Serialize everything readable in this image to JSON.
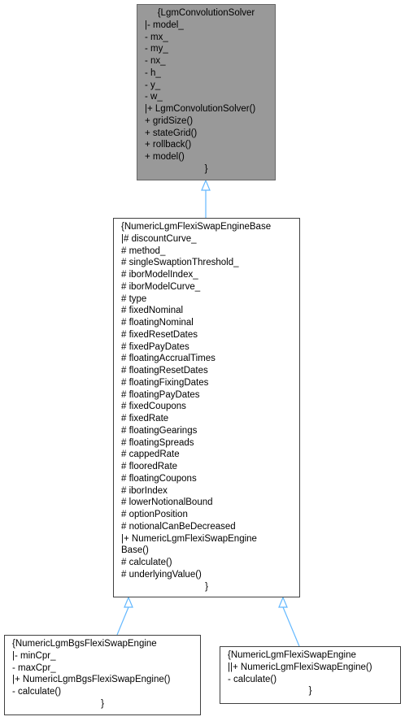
{
  "classes": {
    "solver": {
      "header": "{LgmConvolutionSolver",
      "lines": [
        "|- model_",
        "- mx_",
        "- my_",
        "- nx_",
        "- h_",
        "- y_",
        "- w_",
        "|+ LgmConvolutionSolver()",
        "+ gridSize()",
        "+ stateGrid()",
        "+ rollback()",
        "+ model()"
      ],
      "footer": "}"
    },
    "base": {
      "lines": [
        "{NumericLgmFlexiSwapEngineBase",
        "|# discountCurve_",
        "# method_",
        "# singleSwaptionThreshold_",
        "# iborModelIndex_",
        "# iborModelCurve_",
        "# type",
        "# fixedNominal",
        "# floatingNominal",
        "# fixedResetDates",
        "# fixedPayDates",
        "# floatingAccrualTimes",
        "# floatingResetDates",
        "# floatingFixingDates",
        "# floatingPayDates",
        "# fixedCoupons",
        "# fixedRate",
        "# floatingGearings",
        "# floatingSpreads",
        "# cappedRate",
        "# flooredRate",
        "# floatingCoupons",
        "# iborIndex",
        "# lowerNotionalBound",
        "# optionPosition",
        "# notionalCanBeDecreased",
        "|+ NumericLgmFlexiSwapEngine",
        "Base()",
        "# calculate()",
        "# underlyingValue()"
      ],
      "footer": "}"
    },
    "bgs": {
      "lines": [
        "{NumericLgmBgsFlexiSwapEngine",
        "|- minCpr_",
        "- maxCpr_",
        "|+ NumericLgmBgsFlexiSwapEngine()",
        "- calculate()"
      ],
      "footer": "}"
    },
    "flexi": {
      "lines": [
        "{NumericLgmFlexiSwapEngine",
        "||+ NumericLgmFlexiSwapEngine()",
        "- calculate()"
      ],
      "footer": "}"
    }
  },
  "colors": {
    "edge": "#63b8ff",
    "highlight_fill": "#999999",
    "border": "#404040"
  }
}
